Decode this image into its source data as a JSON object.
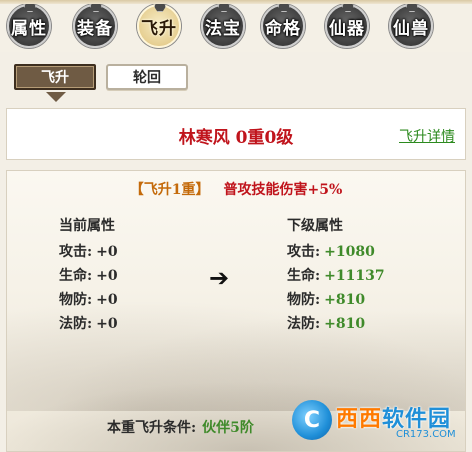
{
  "tabs": [
    {
      "label": "属性",
      "active": false
    },
    {
      "label": "装备",
      "active": false
    },
    {
      "label": "飞升",
      "active": true
    },
    {
      "label": "法宝",
      "active": false
    },
    {
      "label": "命格",
      "active": false
    },
    {
      "label": "仙器",
      "active": false
    },
    {
      "label": "仙兽",
      "active": false
    }
  ],
  "subtabs": {
    "active_label": "飞升",
    "inactive_label": "轮回"
  },
  "name_panel": {
    "title": "林寒风 0重0级",
    "details_link": "飞升详情"
  },
  "main": {
    "stage": "【飞升1重】",
    "effect": "普攻技能伤害+5%",
    "current_title": "当前属性",
    "next_title": "下级属性",
    "current_stats": [
      {
        "key": "攻击:",
        "value": "+0"
      },
      {
        "key": "生命:",
        "value": "+0"
      },
      {
        "key": "物防:",
        "value": "+0"
      },
      {
        "key": "法防:",
        "value": "+0"
      }
    ],
    "next_stats": [
      {
        "key": "攻击:",
        "value": "+1080"
      },
      {
        "key": "生命:",
        "value": "+11137"
      },
      {
        "key": "物防:",
        "value": "+810"
      },
      {
        "key": "法防:",
        "value": "+810"
      }
    ],
    "arrow": "➔",
    "condition_label": "本重飞升条件:",
    "condition_value": "伙伴5阶"
  },
  "watermark": {
    "logo": "C",
    "main_a": "西西",
    "main_b": "软件园",
    "sub": "CR173.COM"
  },
  "colors": {
    "title_red": "#c0141c",
    "link_green": "#2c8a1e",
    "stage_orange": "#c46a0a",
    "stat_green": "#3f8a2a",
    "subtab_brown": "#6f5b44"
  }
}
